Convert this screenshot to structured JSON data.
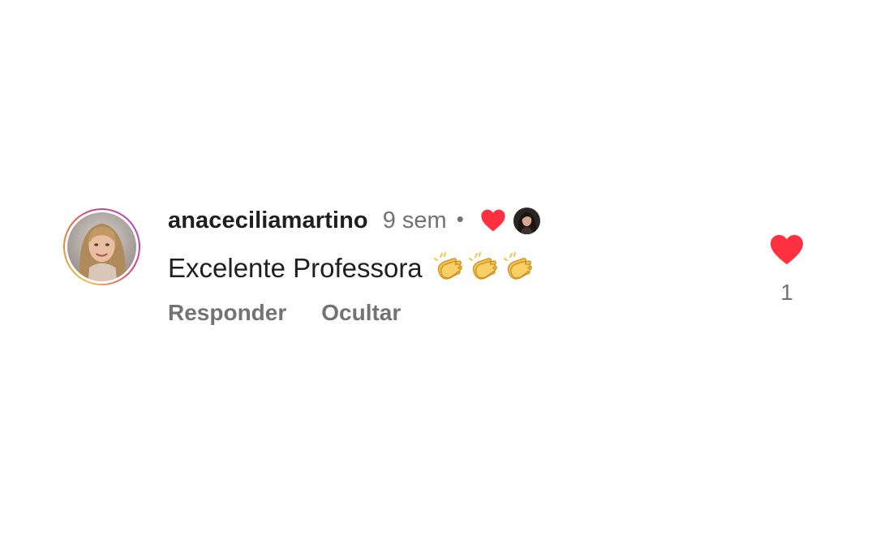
{
  "comment": {
    "username": "anaceciliamartino",
    "timestamp": "9 sem",
    "separator": "•",
    "text": "Excelente Professora",
    "emojis": [
      "clapping-hands",
      "clapping-hands",
      "clapping-hands"
    ],
    "liked_by_creator": true,
    "actions": {
      "reply_label": "Responder",
      "hide_label": "Ocultar"
    },
    "like_count": "1"
  },
  "colors": {
    "background": "#ffffff",
    "primary_text": "#1f1f1f",
    "secondary_text": "#737373",
    "heart_red": "#ff3040",
    "clap_yellow": "#f6c24a"
  }
}
